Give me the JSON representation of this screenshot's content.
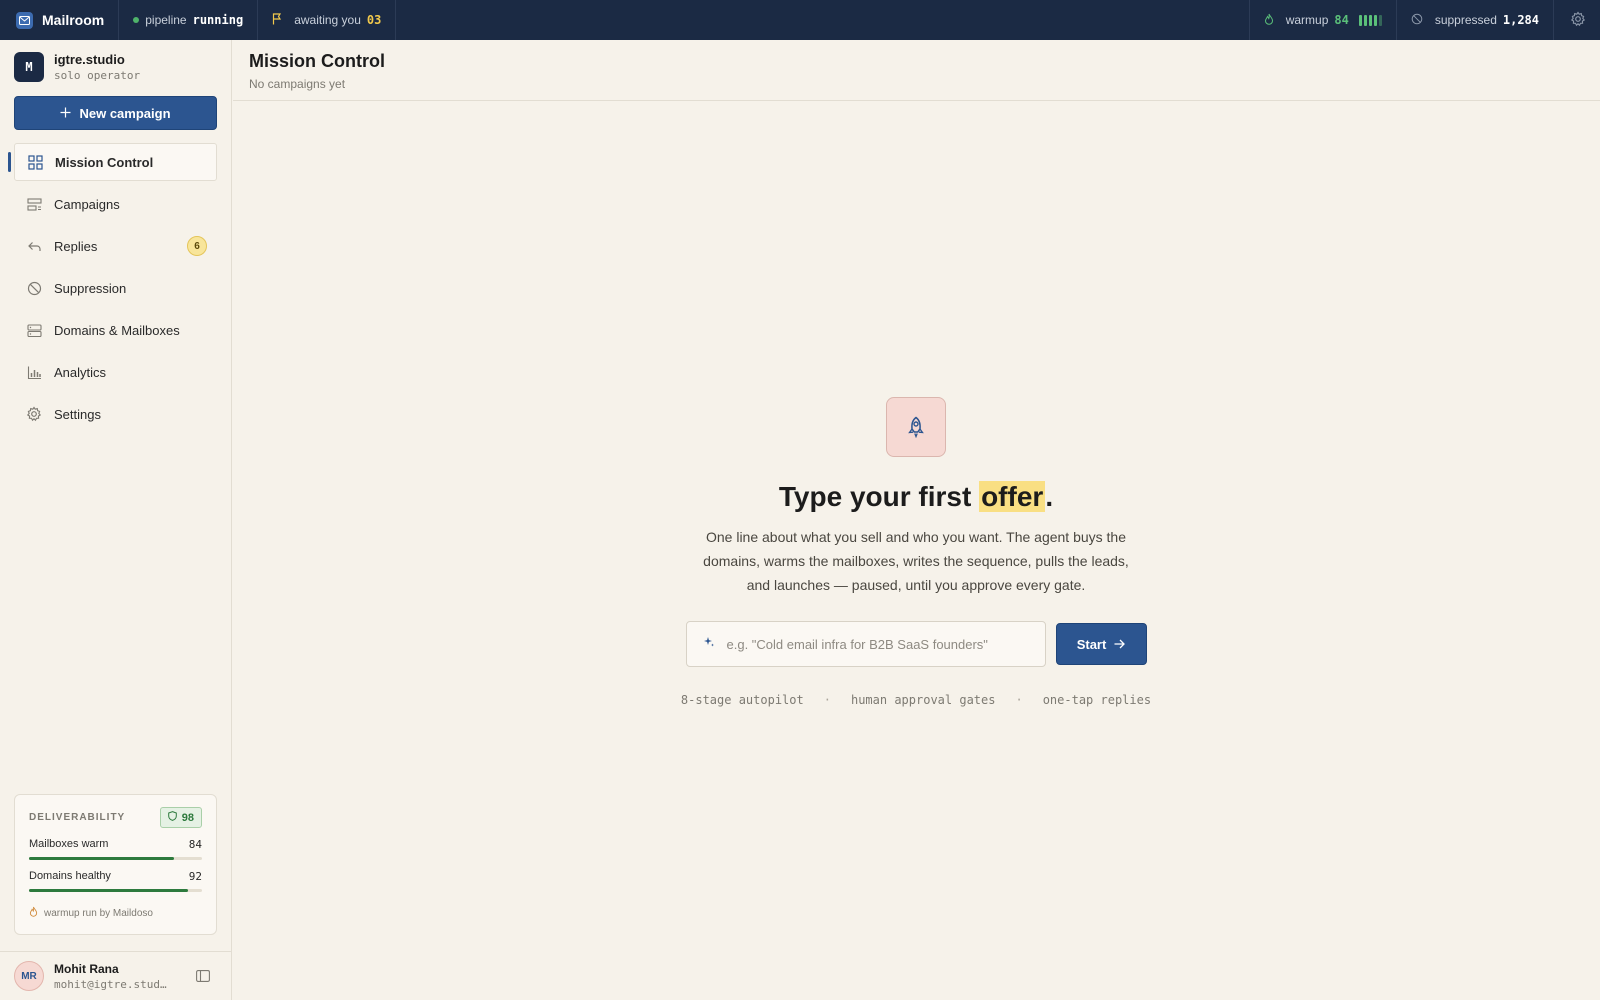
{
  "topbar": {
    "brand": "Mailroom",
    "pipeline_label": "pipeline",
    "pipeline_status": "running",
    "awaiting_label": "awaiting you",
    "awaiting_count": "03",
    "warmup_label": "warmup",
    "warmup_value": "84",
    "suppressed_label": "suppressed",
    "suppressed_value": "1,284"
  },
  "workspace": {
    "initial": "M",
    "name": "igtre.studio",
    "role": "solo operator"
  },
  "new_campaign_label": "New campaign",
  "nav": [
    {
      "label": "Mission Control",
      "icon": "dashboard-icon",
      "active": true
    },
    {
      "label": "Campaigns",
      "icon": "campaigns-icon"
    },
    {
      "label": "Replies",
      "icon": "reply-icon",
      "badge": "6"
    },
    {
      "label": "Suppression",
      "icon": "block-icon"
    },
    {
      "label": "Domains & Mailboxes",
      "icon": "server-icon"
    },
    {
      "label": "Analytics",
      "icon": "bar-chart-icon"
    },
    {
      "label": "Settings",
      "icon": "gear-icon"
    }
  ],
  "deliverability": {
    "title": "DELIVERABILITY",
    "score": "98",
    "rows": [
      {
        "label": "Mailboxes warm",
        "value": "84",
        "pct": 84
      },
      {
        "label": "Domains healthy",
        "value": "92",
        "pct": 92
      }
    ],
    "footer": "warmup run by Maildoso"
  },
  "user": {
    "initials": "MR",
    "name": "Mohit Rana",
    "email": "mohit@igtre.stud…"
  },
  "header": {
    "title": "Mission Control",
    "subtitle": "No campaigns yet"
  },
  "hero": {
    "title_pre": "Type your first ",
    "title_highlight": "offer",
    "title_post": ".",
    "description": "One line about what you sell and who you want. The agent buys the domains, warms the mailboxes, writes the sequence, pulls the leads, and launches — paused, until you approve every gate.",
    "input_placeholder": "e.g. \"Cold email infra for B2B SaaS founders\"",
    "input_value": "",
    "start_label": "Start",
    "chips": [
      "8-stage autopilot",
      "human approval gates",
      "one-tap replies"
    ],
    "chip_separator": "·"
  },
  "colors": {
    "navy": "#1b2a44",
    "accent": "#2c5590",
    "success": "#2d7a3d",
    "highlight": "#f9df83",
    "background": "#f6f2ea"
  }
}
